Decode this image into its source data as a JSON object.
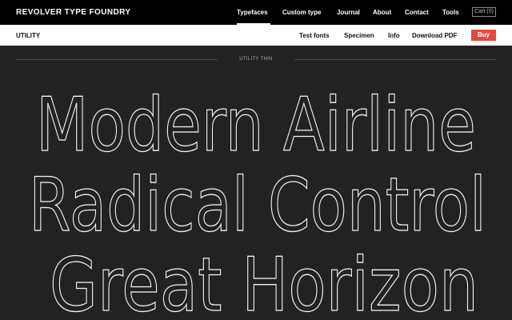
{
  "header": {
    "logo": "REVOLVER TYPE FOUNDRY",
    "nav": [
      {
        "label": "Typefaces",
        "active": true
      },
      {
        "label": "Custom type"
      },
      {
        "label": "Journal"
      },
      {
        "label": "About"
      },
      {
        "label": "Contact"
      },
      {
        "label": "Tools"
      }
    ],
    "cart_label": "Cart (0)"
  },
  "subheader": {
    "product": "UTILITY",
    "links": [
      "Test fonts",
      "Specimen",
      "Info",
      "Download PDF"
    ],
    "buy_label": "Buy"
  },
  "specimen": {
    "style_name": "UTILITY THIN",
    "lines": [
      "Modern Airline",
      "Radical Control",
      "Great Horizon"
    ]
  },
  "colors": {
    "topbar": "#000000",
    "background": "#222222",
    "buy_button": "#e34a43",
    "specimen_stroke": "#f2f2f2"
  }
}
